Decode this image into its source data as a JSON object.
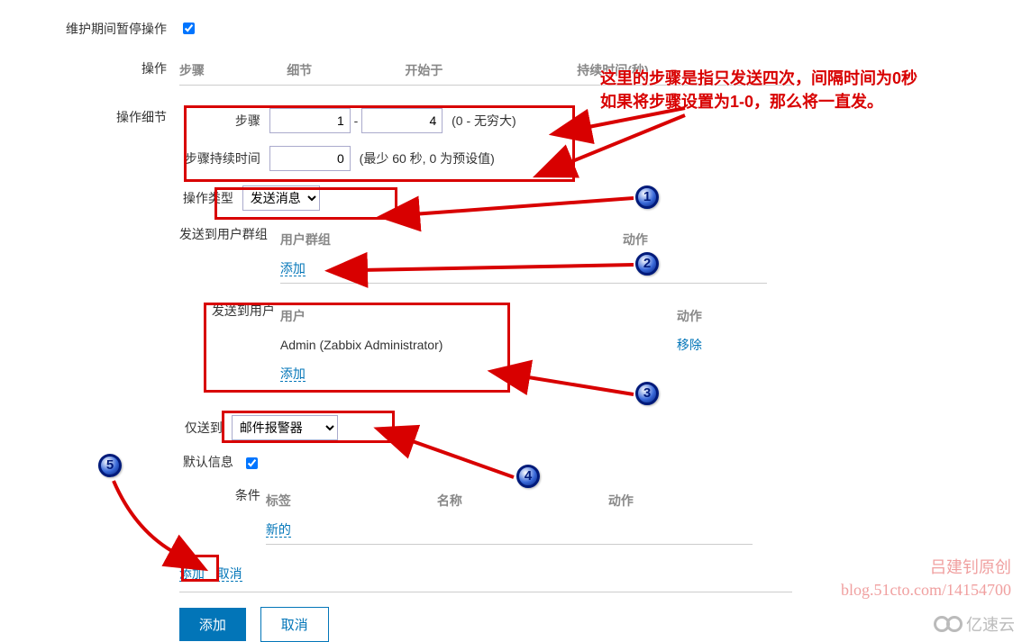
{
  "maintenance_pause_label": "维护期间暂停操作",
  "operation_label": "操作",
  "operation_details_label": "操作细节",
  "table_headers": {
    "step": "步骤",
    "detail": "细节",
    "start_at": "开始于",
    "duration": "持续时间(秒)"
  },
  "steps": {
    "label": "步骤",
    "from": "1",
    "to": "4",
    "note": "(0 - 无穷大)"
  },
  "step_duration": {
    "label": "步骤持续时间",
    "value": "0",
    "note": "(最少 60 秒, 0 为预设值)"
  },
  "op_type": {
    "label": "操作类型",
    "value": "发送消息"
  },
  "send_to_group": {
    "label": "发送到用户群组",
    "col_user": "用户群组",
    "col_action": "动作",
    "add": "添加"
  },
  "send_to_user": {
    "label": "发送到用户",
    "col_user": "用户",
    "col_action": "动作",
    "value": "Admin (Zabbix Administrator)",
    "remove": "移除",
    "add": "添加"
  },
  "only_to": {
    "label": "仅送到",
    "value": "邮件报警器"
  },
  "default_msg_label": "默认信息",
  "conditions": {
    "label": "条件",
    "col_tag": "标签",
    "col_name": "名称",
    "col_action": "动作",
    "new": "新的"
  },
  "inner_add": "添加",
  "inner_cancel": "取消",
  "btn_add": "添加",
  "btn_cancel": "取消",
  "annotation_l1": "这里的步骤是指只发送四次，间隔时间为0秒",
  "annotation_l2": "如果将步骤设置为1-0，那么将一直发。",
  "bullets": {
    "b1": "1",
    "b2": "2",
    "b3": "3",
    "b4": "4",
    "b5": "5"
  },
  "wm_l1": "吕建钊原创",
  "wm_l2": "blog.51cto.com/14154700",
  "wm_brand": "亿速云"
}
